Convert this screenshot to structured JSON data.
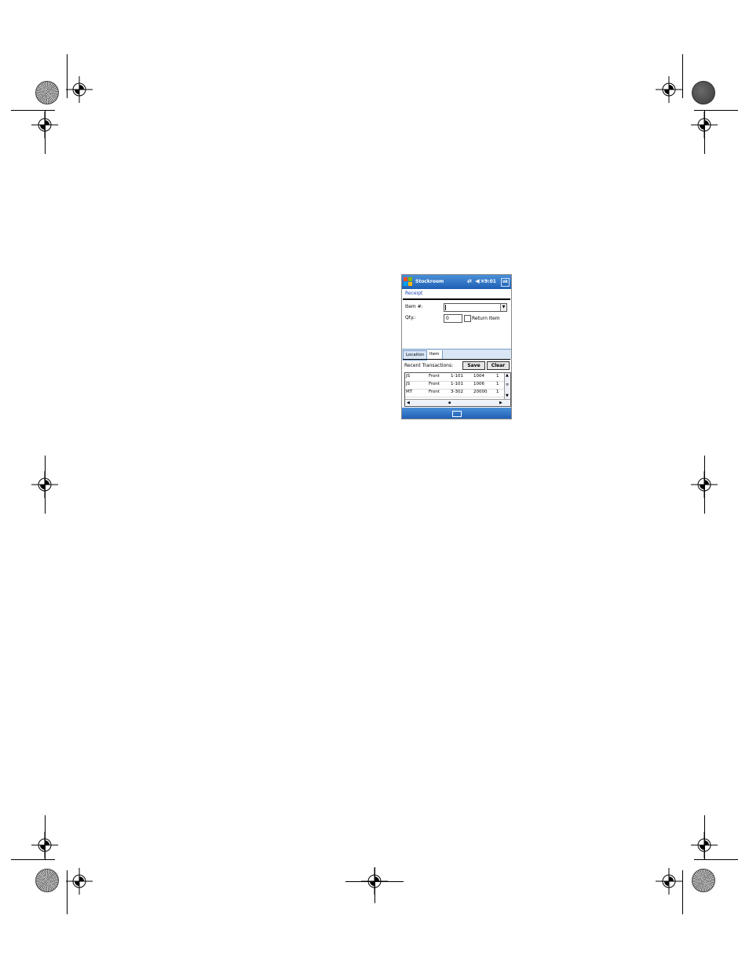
{
  "device": {
    "titlebar": {
      "app_title": "Stockroom",
      "status_icons": "⇄ ◀×",
      "time": "9:01",
      "ok_label": "ok"
    },
    "form": {
      "title": "Receipt",
      "item_label": "Item #:",
      "item_value": "",
      "qty_label": "Qty.:",
      "qty_value": "0",
      "return_item_label": "Return Item",
      "return_item_checked": false
    },
    "tabs": [
      {
        "label": "Location",
        "active": false
      },
      {
        "label": "Item",
        "active": true
      }
    ],
    "recent": {
      "label": "Recent Transactions:",
      "save_label": "Save",
      "clear_label": "Clear",
      "rows": [
        [
          "JS",
          "Front",
          "1-101",
          "1004",
          "1"
        ],
        [
          "JS",
          "Front",
          "1-101",
          "1006",
          "1"
        ],
        [
          "MT",
          "Front",
          "3-302",
          "20000",
          "1"
        ]
      ]
    },
    "icons": {
      "start": "windows-logo-icon",
      "keyboard": "keyboard-icon"
    },
    "colors": {
      "titlebar": "#1f5fb4",
      "form_title": "#1a3fb0",
      "tab_bg": "#d9e6f5"
    }
  }
}
